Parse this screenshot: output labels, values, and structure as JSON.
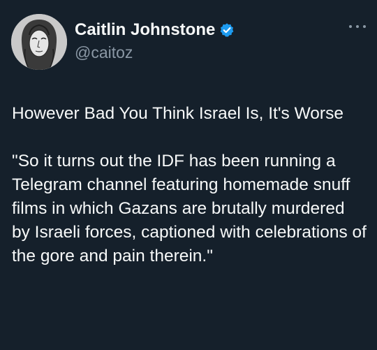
{
  "author": {
    "display_name": "Caitlin Johnstone",
    "handle": "@caitoz",
    "verified_icon": "verified-badge-icon",
    "verified_color": "#1d9bf0",
    "avatar_icon": "portrait-sketch-avatar"
  },
  "menu": {
    "icon": "more-options-icon"
  },
  "tweet": {
    "title": "However Bad You Think Israel Is, It's Worse",
    "quote": "\"So it turns out the IDF has been running a Telegram channel featuring homemade snuff films in which Gazans are brutally murdered by Israeli forces, captioned with celebrations of the gore and pain therein.\""
  },
  "theme": {
    "background": "#15202b",
    "text": "#f7f9f9",
    "secondary_text": "#8b98a5"
  }
}
